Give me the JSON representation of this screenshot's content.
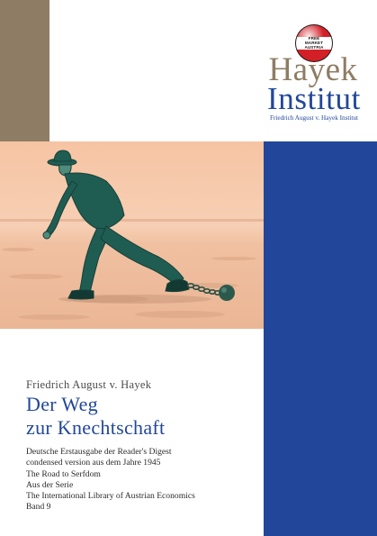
{
  "colors": {
    "brand_brown": "#8e7d64",
    "brand_blue": "#22479a",
    "photo_sand": "#f2bfa0",
    "photo_figure": "#1f5d52"
  },
  "logo": {
    "badge_lines": [
      "FREE",
      "MARKET",
      "AUSTRIA"
    ],
    "name_line1": "Hayek",
    "name_line2": "Institut",
    "subline": "Friedrich August v. Hayek Institut"
  },
  "illustration": {
    "icon": "man-with-ball-and-chain-icon"
  },
  "book": {
    "author": "Friedrich August v. Hayek",
    "title_lines": [
      "Der Weg",
      "zur Knechtschaft"
    ],
    "details": [
      "Deutsche Erstausgabe der Reader's Digest",
      "condensed version aus dem Jahre 1945",
      "The Road to Serfdom",
      "Aus der Serie",
      "The International Library of Austrian Economics",
      "Band 9"
    ]
  }
}
